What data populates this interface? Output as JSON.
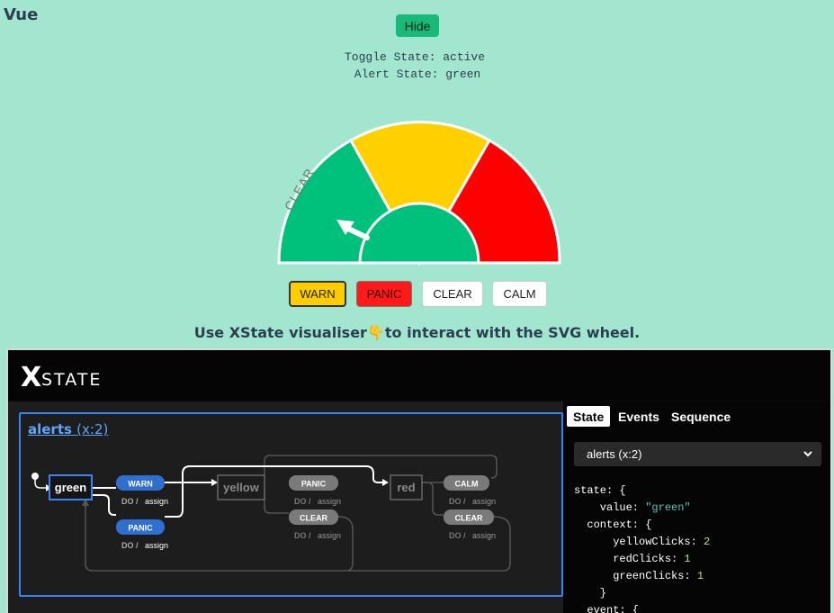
{
  "app": {
    "title": "Vue"
  },
  "controls": {
    "hide_label": "Hide"
  },
  "status": {
    "toggle_line": "Toggle State: active",
    "alert_line": " Alert State: green"
  },
  "wheel": {
    "label": "CLEAR",
    "segments": [
      {
        "name": "green",
        "color": "#00c17c"
      },
      {
        "name": "yellow",
        "color": "#ffd000"
      },
      {
        "name": "red",
        "color": "#ff0000"
      }
    ],
    "center_color": "#00c17c",
    "arrow_color": "#ffffff"
  },
  "buttons": {
    "warn": "WARN",
    "panic": "PANIC",
    "clear": "CLEAR",
    "calm": "CALM"
  },
  "hint": {
    "before": "Use XState visualiser",
    "emoji": "👇",
    "after": "to interact with the SVG wheel."
  },
  "visualizer": {
    "logo_x": "X",
    "logo_text": "STATE",
    "machine": {
      "name": "alerts",
      "id": "(x:2)"
    },
    "states": {
      "green": "green",
      "yellow": "yellow",
      "red": "red"
    },
    "events": {
      "warn": "WARN",
      "panic_green": "PANIC",
      "panic_yellow": "PANIC",
      "clear_yellow": "CLEAR",
      "calm": "CALM",
      "clear_red": "CLEAR"
    },
    "action": {
      "do": "DO /",
      "name": "assign"
    },
    "tabs": [
      "State",
      "Events",
      "Sequence"
    ],
    "select_value": "alerts (x:2)",
    "code": {
      "l1": "state: {",
      "l2_key": "    value: ",
      "l2_val": "\"green\"",
      "l3": "  context: {",
      "l4_key": "      yellowClicks: ",
      "l4_val": "2",
      "l5_key": "      redClicks: ",
      "l5_val": "1",
      "l6_key": "      greenClicks: ",
      "l6_val": "1",
      "l7": "    }",
      "l8": "  event: {"
    }
  }
}
